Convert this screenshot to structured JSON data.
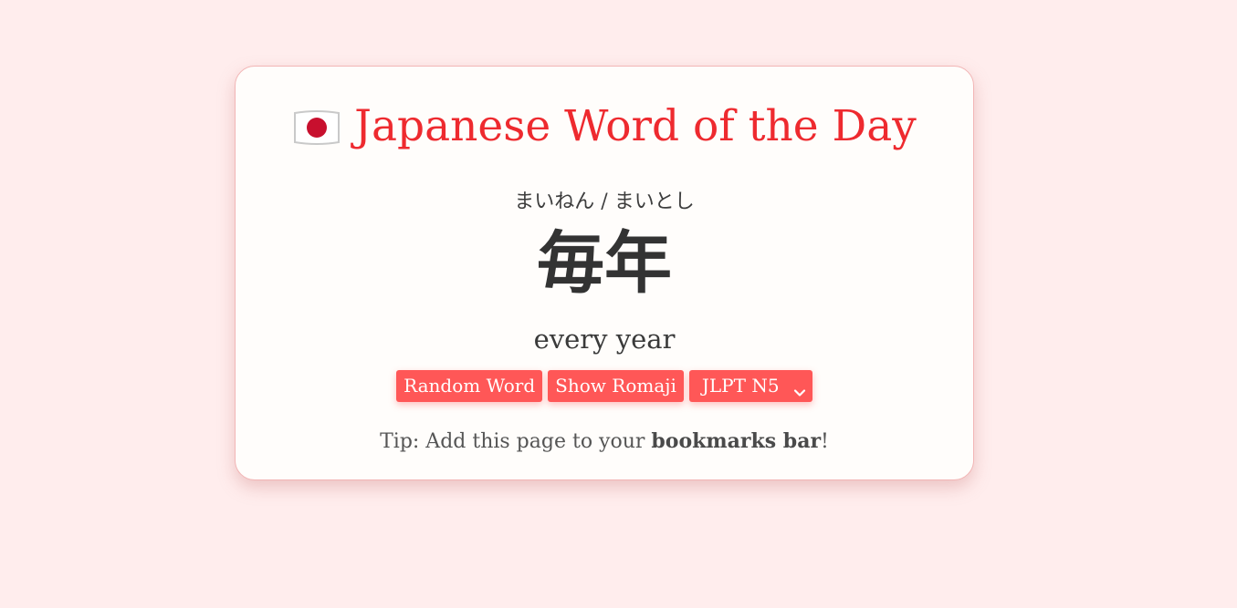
{
  "title": {
    "flag_icon": "japan-flag-icon",
    "text": "Japanese Word of the Day",
    "color": "#ee2a2f"
  },
  "word": {
    "reading": "まいねん / まいとし",
    "kanji": "毎年",
    "meaning": "every year"
  },
  "controls": {
    "random_label": "Random Word",
    "romaji_label": "Show Romaji",
    "level_selected": "JLPT N5",
    "button_color": "#ff5757"
  },
  "tip": {
    "prefix": "Tip: Add this page to your ",
    "bold": "bookmarks bar",
    "suffix": "!"
  },
  "colors": {
    "background": "#ffeded",
    "card": "#fffdfb"
  }
}
